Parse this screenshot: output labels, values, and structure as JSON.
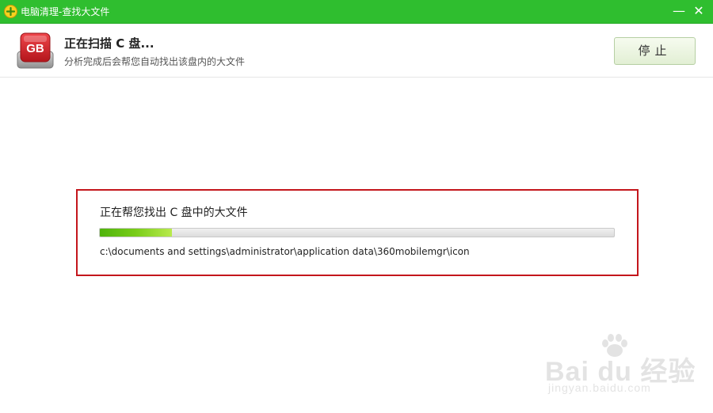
{
  "window": {
    "title": "电脑清理-查找大文件",
    "minimize_glyph": "—",
    "close_glyph": "✕"
  },
  "header": {
    "icon_text": "GB",
    "title": "正在扫描 C 盘...",
    "subtitle": "分析完成后会帮您自动找出该盘内的大文件",
    "stop_label": "停止"
  },
  "scan": {
    "label": "正在帮您找出 C 盘中的大文件",
    "progress": 0.14,
    "current_path": "c:\\documents and settings\\administrator\\application data\\360mobilemgr\\icon"
  },
  "watermark": {
    "main": "Bai du 经验",
    "sub": "jingyan.baidu.com"
  },
  "colors": {
    "titlebar": "#2fbe2f",
    "highlight_border": "#c4161c",
    "progress_fill": "#79cd19",
    "icon_red": "#d9262c"
  }
}
